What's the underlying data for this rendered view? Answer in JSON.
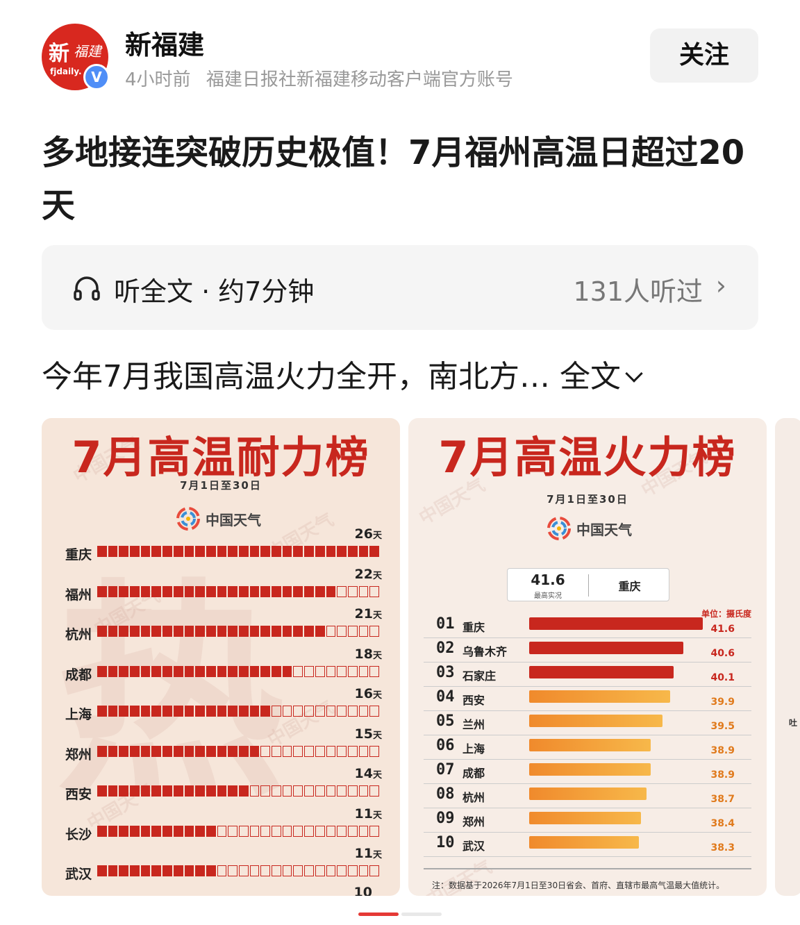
{
  "account": {
    "avatar_big": "新",
    "avatar_small": "福建",
    "avatar_en": "fjdaily.",
    "verified": "V",
    "name": "新福建",
    "time": "4小时前",
    "desc": "福建日报社新福建移动客户端官方账号",
    "follow_label": "关注"
  },
  "article": {
    "title": "多地接连突破历史极值！7月福州高温日超过20天",
    "summary": "今年7月我国高温火力全开，南北方…",
    "full_label": "全文"
  },
  "listen": {
    "icon": "headphones-icon",
    "label": "听全文 · 约7分钟",
    "count": "131人听过",
    "chevron": "›"
  },
  "card1": {
    "title": "7月高温耐力榜",
    "date": "7月1日至30日",
    "brand": "中国天气",
    "bg_char": "热",
    "watermark": "中国天气",
    "unit": "天",
    "last_partial": "10",
    "chart_data": {
      "type": "bar",
      "title": "7月高温耐力榜",
      "subtitle": "7月1日至30日",
      "categories": [
        "重庆",
        "福州",
        "杭州",
        "成都",
        "上海",
        "郑州",
        "西安",
        "长沙",
        "武汉"
      ],
      "values": [
        26,
        22,
        21,
        18,
        16,
        15,
        14,
        11,
        11
      ],
      "max": 26,
      "unit": "天"
    }
  },
  "card2": {
    "title": "7月高温火力榜",
    "date": "7月1日至30日",
    "brand": "中国天气",
    "watermark": "中国天气",
    "top_value": "41.6",
    "top_sub": "最高实况",
    "top_city": "重庆",
    "unit_label": "单位：摄氏度",
    "footnote": "注：数据基于2026年7月1日至30日省会、首府、直辖市最高气温最大值统计。",
    "colors": {
      "hot": "#c8271e",
      "warm": "#f08a2c"
    },
    "chart_data": {
      "type": "bar",
      "title": "7月高温火力榜",
      "subtitle": "7月1日至30日",
      "ranks": [
        "01",
        "02",
        "03",
        "04",
        "05",
        "06",
        "07",
        "08",
        "09",
        "10"
      ],
      "categories": [
        "重庆",
        "乌鲁木齐",
        "石家庄",
        "西安",
        "兰州",
        "上海",
        "成都",
        "杭州",
        "郑州",
        "武汉"
      ],
      "values": [
        41.6,
        40.6,
        40.1,
        39.9,
        39.5,
        38.9,
        38.9,
        38.7,
        38.4,
        38.3
      ],
      "unit": "摄氏度"
    }
  },
  "card3": {
    "peek_text": "吐"
  }
}
